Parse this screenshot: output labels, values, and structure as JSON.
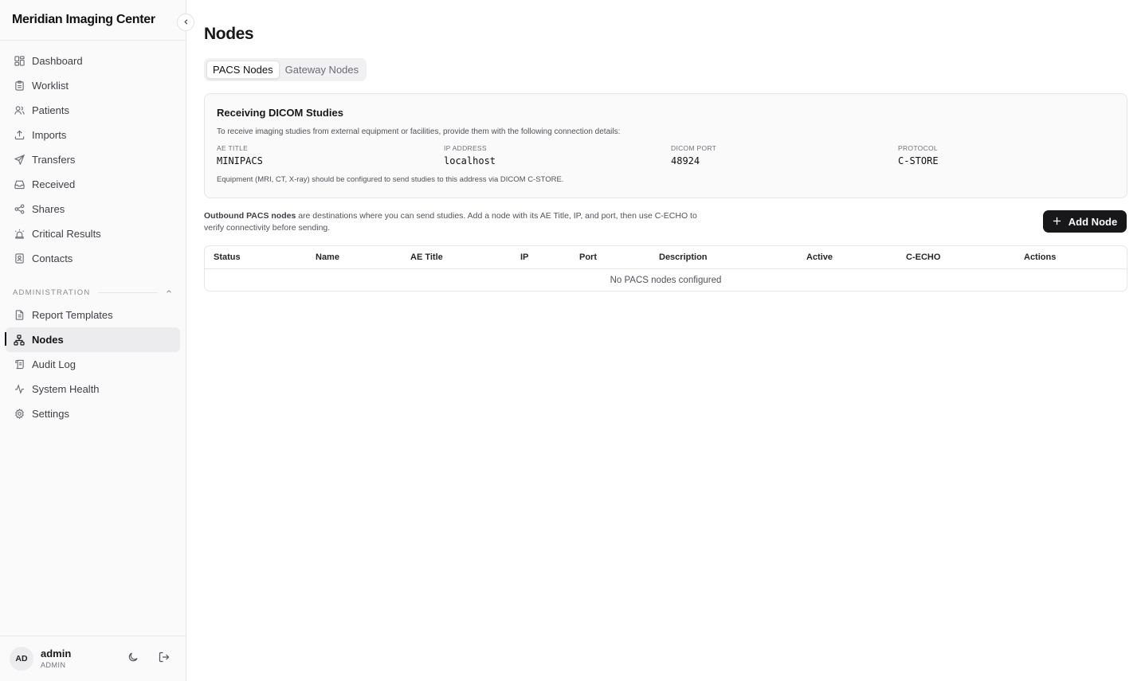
{
  "app": {
    "title": "Meridian Imaging Center"
  },
  "nav": {
    "items": [
      {
        "label": "Dashboard",
        "icon": "dashboard-icon"
      },
      {
        "label": "Worklist",
        "icon": "clipboard-icon"
      },
      {
        "label": "Patients",
        "icon": "users-icon"
      },
      {
        "label": "Imports",
        "icon": "upload-icon"
      },
      {
        "label": "Transfers",
        "icon": "send-icon"
      },
      {
        "label": "Received",
        "icon": "inbox-icon"
      },
      {
        "label": "Shares",
        "icon": "share-icon"
      },
      {
        "label": "Critical Results",
        "icon": "siren-icon"
      },
      {
        "label": "Contacts",
        "icon": "contact-book-icon"
      }
    ],
    "admin_section": "ADMINISTRATION",
    "admin_items": [
      {
        "label": "Report Templates",
        "icon": "file-text-icon"
      },
      {
        "label": "Nodes",
        "icon": "network-icon",
        "active": true
      },
      {
        "label": "Audit Log",
        "icon": "scroll-icon"
      },
      {
        "label": "System Health",
        "icon": "activity-icon"
      },
      {
        "label": "Settings",
        "icon": "gear-icon"
      }
    ]
  },
  "user": {
    "initials": "AD",
    "name": "admin",
    "role": "ADMIN"
  },
  "page": {
    "title": "Nodes",
    "tabs": [
      {
        "label": "PACS Nodes",
        "active": true
      },
      {
        "label": "Gateway Nodes",
        "active": false
      }
    ]
  },
  "receiving": {
    "title": "Receiving DICOM Studies",
    "description": "To receive imaging studies from external equipment or facilities, provide them with the following connection details:",
    "fields": [
      {
        "label": "AE TITLE",
        "value": "MINIPACS"
      },
      {
        "label": "IP ADDRESS",
        "value": "localhost"
      },
      {
        "label": "DICOM PORT",
        "value": "48924"
      },
      {
        "label": "PROTOCOL",
        "value": "C-STORE"
      }
    ],
    "note": "Equipment (MRI, CT, X-ray) should be configured to send studies to this address via DICOM C-STORE."
  },
  "outbound": {
    "bold": "Outbound PACS nodes",
    "text": " are destinations where you can send studies. Add a node with its AE Title, IP, and port, then use C-ECHO to verify connectivity before sending."
  },
  "add_button": {
    "label": "Add Node"
  },
  "table": {
    "headers": [
      "Status",
      "Name",
      "AE Title",
      "IP",
      "Port",
      "Description",
      "Active",
      "C-ECHO",
      "Actions"
    ],
    "empty": "No PACS nodes configured"
  }
}
